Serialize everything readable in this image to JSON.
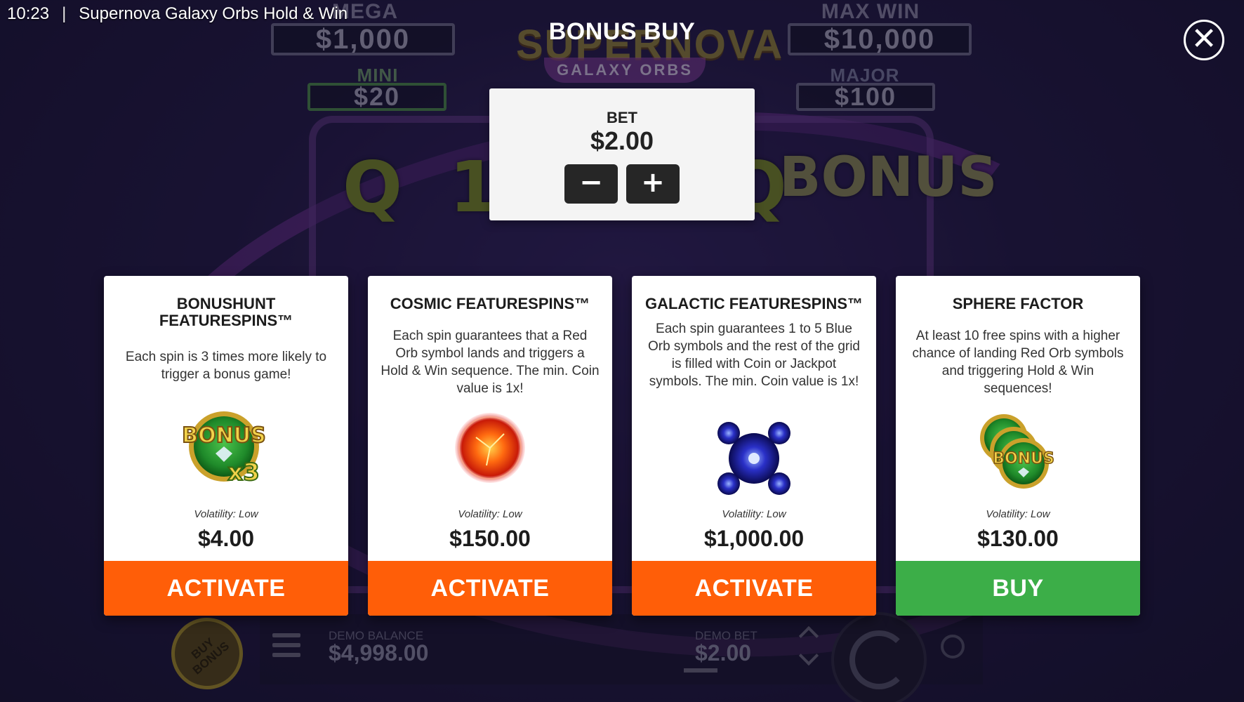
{
  "status_bar": {
    "time": "10:23",
    "separator": "|",
    "app_title": "Supernova Galaxy Orbs Hold & Win"
  },
  "background": {
    "jackpots": {
      "mega": {
        "label": "MEGA",
        "value": "$1,000"
      },
      "max_win": {
        "label": "MAX WIN",
        "value": "$10,000"
      },
      "mini": {
        "label": "MINI",
        "value": "$20"
      },
      "major": {
        "label": "MAJOR",
        "value": "$100"
      }
    },
    "logo_text": "SUPERNOVA",
    "logo_sub": "GALAXY ORBS",
    "reel_symbols": [
      "Q",
      "1",
      "Q",
      "BONUS"
    ],
    "buy_bonus_label": "BUY BONUS",
    "demo_balance_label": "DEMO BALANCE",
    "demo_balance_value": "$4,998.00",
    "demo_bet_label": "DEMO BET",
    "demo_bet_value": "$2.00"
  },
  "modal": {
    "title": "BONUS BUY",
    "close_symbol": "✕",
    "bet": {
      "label": "BET",
      "value": "$2.00",
      "minus": "−",
      "plus": "+"
    },
    "cards": [
      {
        "title": "BONUSHUNT FEATURESPINS™",
        "description": "Each spin is 3 times more likely to trigger a bonus game!",
        "image_icon": "bonus-x3-icon",
        "image_text": "BONUS",
        "image_multiplier": "x3",
        "volatility": "Volatility: Low",
        "price": "$4.00",
        "action": "ACTIVATE",
        "action_color": "#ff5e08"
      },
      {
        "title": "COSMIC FEATURESPINS™",
        "description": "Each spin guarantees that a Red Orb symbol lands and triggers a Hold & Win sequence. The min. Coin value is 1x!",
        "image_icon": "red-orb-icon",
        "volatility": "Volatility: Low",
        "price": "$150.00",
        "action": "ACTIVATE",
        "action_color": "#ff5e08"
      },
      {
        "title": "GALACTIC FEATURESPINS™",
        "description": "Each spin guarantees 1 to 5 Blue Orb symbols and the rest of the grid is filled with Coin or Jackpot symbols. The min. Coin value is 1x!",
        "image_icon": "blue-orbs-icon",
        "volatility": "Volatility: Low",
        "price": "$1,000.00",
        "action": "ACTIVATE",
        "action_color": "#ff5e08"
      },
      {
        "title": "SPHERE FACTOR",
        "description": "At least 10 free spins with a higher chance of landing Red Orb symbols and triggering Hold & Win sequences!",
        "image_icon": "bonus-stack-icon",
        "image_text": "BONUS",
        "volatility": "Volatility: Low",
        "price": "$130.00",
        "action": "BUY",
        "action_color": "#3cae48"
      }
    ]
  }
}
